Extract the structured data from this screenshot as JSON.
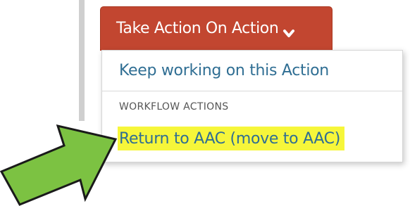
{
  "button": {
    "label": "Take Action On Action",
    "icon": "chevron-down-icon",
    "color": "#c24630"
  },
  "menu": {
    "keep_label": "Keep working on this Action",
    "section_header": "WORKFLOW ACTIONS",
    "return_label": "Return to AAC (move to AAC)",
    "link_color": "#2f6e93",
    "highlight_color": "#f6f63a"
  },
  "annotation": {
    "icon": "arrow-right-icon",
    "fill": "#7cc242",
    "stroke": "#1a1a1a"
  }
}
